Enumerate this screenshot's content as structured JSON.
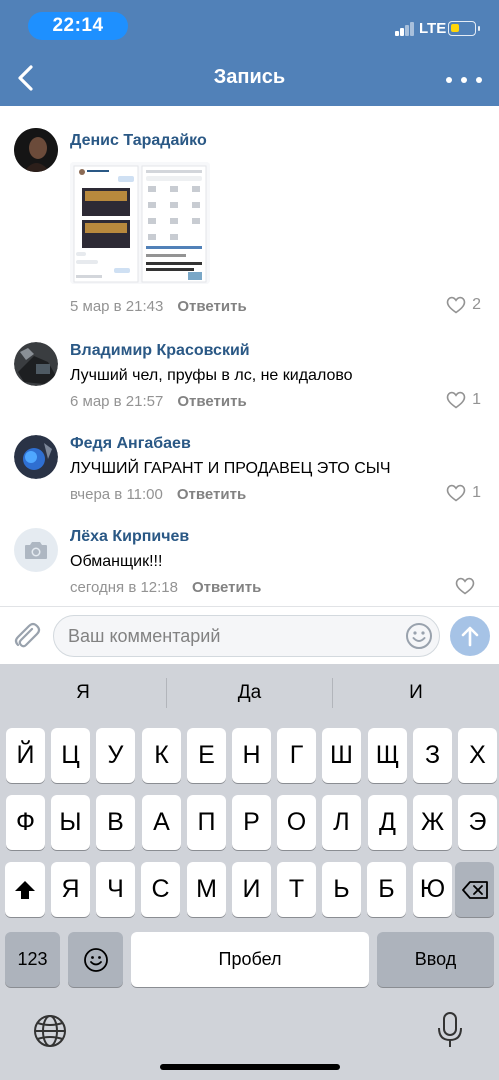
{
  "status": {
    "time": "22:14",
    "network": "LTE",
    "battery_level": 0.35,
    "battery_color": "#ffd60a"
  },
  "header": {
    "title": "Запись",
    "accent": "#5181b8"
  },
  "comments": [
    {
      "author": "Денис Тарадайко",
      "text": "",
      "time": "5 мар в 21:43",
      "reply": "Ответить",
      "likes": "2",
      "has_image": true
    },
    {
      "author": "Владимир Красовский",
      "text": "Лучший чел, пруфы в лс, не кидалово",
      "time": "6 мар в 21:57",
      "reply": "Ответить",
      "likes": "1"
    },
    {
      "author": "Федя Ангабаев",
      "text": "ЛУЧШИЙ ГАРАНТ И ПРОДАВЕЦ ЭТО СЫЧ",
      "time": "вчера в 11:00",
      "reply": "Ответить",
      "likes": "1"
    },
    {
      "author": "Лёха Кирпичев",
      "text": "Обманщик!!!",
      "time": "сегодня в 12:18",
      "reply": "Ответить",
      "likes": ""
    }
  ],
  "composer": {
    "placeholder": "Ваш комментарий"
  },
  "keyboard": {
    "suggestions": [
      "Я",
      "Да",
      "И"
    ],
    "row1": [
      "Й",
      "Ц",
      "У",
      "К",
      "Е",
      "Н",
      "Г",
      "Ш",
      "Щ",
      "З",
      "Х"
    ],
    "row2": [
      "Ф",
      "Ы",
      "В",
      "А",
      "П",
      "Р",
      "О",
      "Л",
      "Д",
      "Ж",
      "Э"
    ],
    "row3": [
      "Я",
      "Ч",
      "С",
      "М",
      "И",
      "Т",
      "Ь",
      "Б",
      "Ю"
    ],
    "numbers_label": "123",
    "space_label": "Пробел",
    "return_label": "Ввод"
  }
}
